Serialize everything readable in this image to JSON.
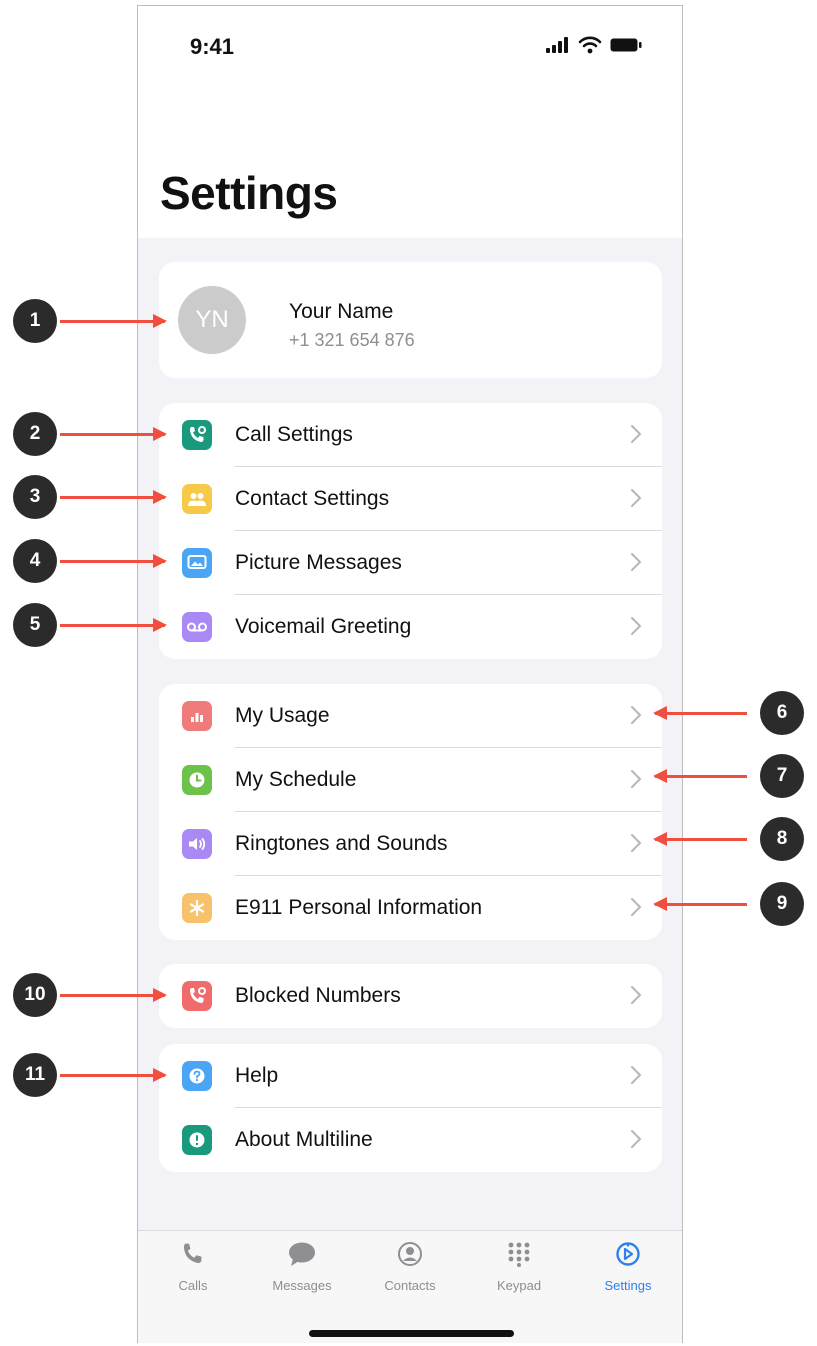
{
  "status_bar": {
    "time": "9:41"
  },
  "header": {
    "title": "Settings"
  },
  "profile": {
    "initials": "YN",
    "name": "Your Name",
    "phone": "+1 321 654 876"
  },
  "groups": [
    {
      "items": [
        {
          "label": "Call Settings",
          "icon": "phone-gear-icon",
          "color": "#1a9a7c"
        },
        {
          "label": "Contact Settings",
          "icon": "people-icon",
          "color": "#f7c948"
        },
        {
          "label": "Picture Messages",
          "icon": "picture-message-icon",
          "color": "#4aa6f5"
        },
        {
          "label": "Voicemail Greeting",
          "icon": "voicemail-icon",
          "color": "#a98af4"
        }
      ]
    },
    {
      "items": [
        {
          "label": "My Usage",
          "icon": "bar-chart-icon",
          "color": "#f07b7b"
        },
        {
          "label": "My Schedule",
          "icon": "clock-icon",
          "color": "#6cc24a"
        },
        {
          "label": "Ringtones and Sounds",
          "icon": "speaker-icon",
          "color": "#a98af4"
        },
        {
          "label": "E911 Personal Information",
          "icon": "asterisk-icon",
          "color": "#f7c26b"
        }
      ]
    },
    {
      "items": [
        {
          "label": "Blocked Numbers",
          "icon": "phone-block-icon",
          "color": "#f06c6c"
        }
      ]
    },
    {
      "items": [
        {
          "label": "Help",
          "icon": "question-icon",
          "color": "#4aa6f5"
        },
        {
          "label": "About Multiline",
          "icon": "info-icon",
          "color": "#1a9a7c"
        }
      ]
    }
  ],
  "tabbar": {
    "tabs": [
      {
        "label": "Calls",
        "icon": "phone-icon",
        "active": false
      },
      {
        "label": "Messages",
        "icon": "chat-bubble-icon",
        "active": false
      },
      {
        "label": "Contacts",
        "icon": "contact-person-icon",
        "active": false
      },
      {
        "label": "Keypad",
        "icon": "keypad-grid-icon",
        "active": false
      },
      {
        "label": "Settings",
        "icon": "settings-gear-icon",
        "active": true
      }
    ],
    "active_color": "#2f80ed"
  },
  "annotations": {
    "badges": [
      "1",
      "2",
      "3",
      "4",
      "5",
      "6",
      "7",
      "8",
      "9",
      "10",
      "11"
    ],
    "arrow_color": "#f04e3e"
  }
}
